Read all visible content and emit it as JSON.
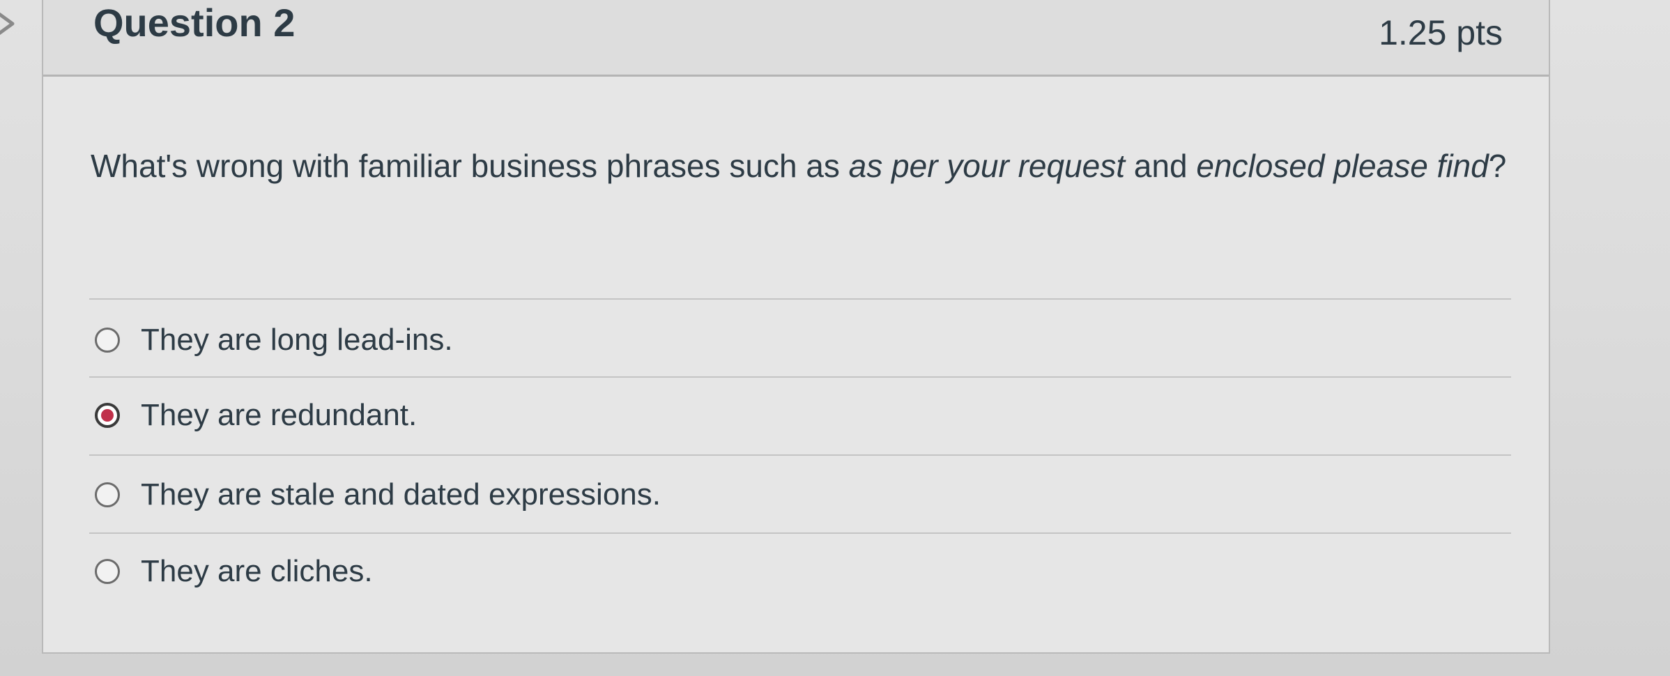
{
  "question": {
    "title": "Question 2",
    "points": "1.25 pts",
    "text_before": "What's wrong with familiar business phrases such as ",
    "phrase_1": "as per your request",
    "text_middle": " and ",
    "phrase_2": "enclosed please find",
    "text_after": "?"
  },
  "answers": [
    {
      "label": "They are long lead-ins.",
      "selected": false
    },
    {
      "label": "They are redundant.",
      "selected": true
    },
    {
      "label": "They are stale and dated expressions.",
      "selected": false
    },
    {
      "label": "They are cliches.",
      "selected": false
    }
  ],
  "colors": {
    "selected_radio": "#c0304a",
    "text": "#2d3b45"
  }
}
